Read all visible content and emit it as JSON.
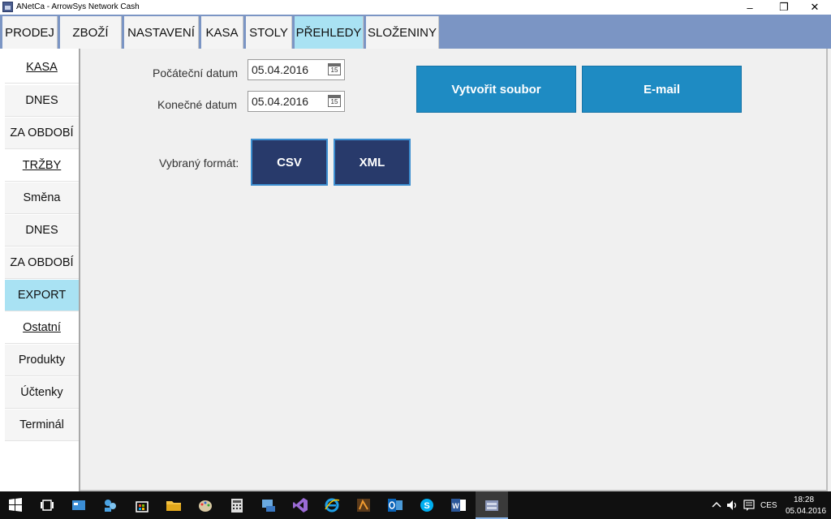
{
  "window": {
    "title": "ANetCa - ArrowSys Network Cash",
    "controls": {
      "minimize": "–",
      "restore": "❐",
      "close": "✕"
    }
  },
  "tabs": [
    {
      "label": "PRODEJ"
    },
    {
      "label": "ZBOŽÍ"
    },
    {
      "label": "NASTAVENÍ"
    },
    {
      "label": "KASA"
    },
    {
      "label": "STOLY"
    },
    {
      "label": "PŘEHLEDY",
      "active": true
    },
    {
      "label": "SLOŽENINY"
    }
  ],
  "sidebar": {
    "items": [
      {
        "label": "KASA",
        "type": "header"
      },
      {
        "label": "DNES"
      },
      {
        "label": "ZA OBDOBÍ"
      },
      {
        "label": "TRŽBY",
        "type": "header"
      },
      {
        "label": "Směna"
      },
      {
        "label": "DNES"
      },
      {
        "label": "ZA OBDOBÍ"
      },
      {
        "label": "EXPORT",
        "active": true
      },
      {
        "label": "Ostatní",
        "type": "header"
      },
      {
        "label": "Produkty"
      },
      {
        "label": "Účtenky"
      },
      {
        "label": "Terminál"
      }
    ]
  },
  "export": {
    "start_date_label": "Počáteční datum",
    "start_date_value": "05.04.2016",
    "end_date_label": "Konečné datum",
    "end_date_value": "05.04.2016",
    "calendar_icon_text": "15",
    "format_label": "Vybraný formát:",
    "format_csv": "CSV",
    "format_xml": "XML",
    "create_file_button": "Vytvořit soubor",
    "email_button": "E-mail"
  },
  "taskbar": {
    "language": "CES",
    "time": "18:28",
    "date": "05.04.2016",
    "icons": [
      "start-icon",
      "task-view-icon",
      "store-icon",
      "people-icon",
      "store-bag-icon",
      "file-explorer-icon",
      "paint-icon",
      "calculator-icon",
      "control-panel-icon",
      "visual-studio-icon",
      "internet-explorer-icon",
      "media-icon",
      "outlook-icon",
      "skype-icon",
      "word-icon",
      "anetca-icon"
    ]
  },
  "colors": {
    "tab_bar": "#7b95c4",
    "active_tab": "#a9e2f3",
    "format_button": "#283a6b",
    "action_button": "#1e8bc3"
  }
}
